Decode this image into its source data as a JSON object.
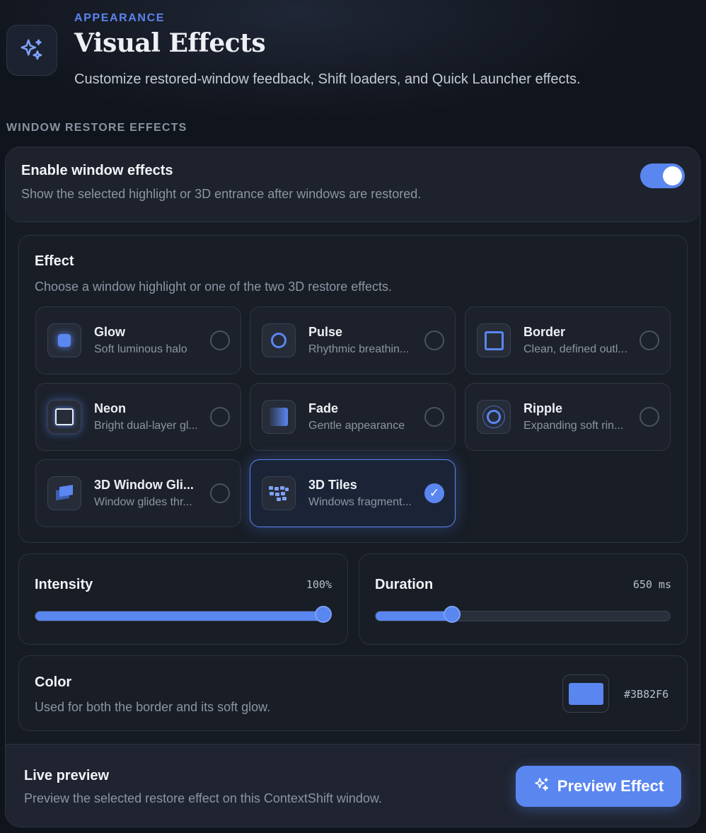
{
  "header": {
    "eyebrow": "APPEARANCE",
    "title": "Visual Effects",
    "subtitle": "Customize restored-window feedback, Shift loaders, and Quick Launcher effects.",
    "icon": "sparkles-icon"
  },
  "section_label": "WINDOW RESTORE EFFECTS",
  "enable": {
    "title": "Enable window effects",
    "description": "Show the selected highlight or 3D entrance after windows are restored.",
    "enabled": true
  },
  "effect": {
    "title": "Effect",
    "description": "Choose a window highlight or one of the two 3D restore effects.",
    "selected": "3D Tiles",
    "options": [
      {
        "name": "Glow",
        "subtitle": "Soft luminous halo",
        "icon": "glow-icon"
      },
      {
        "name": "Pulse",
        "subtitle": "Rhythmic breathin...",
        "icon": "pulse-icon"
      },
      {
        "name": "Border",
        "subtitle": "Clean, defined outl...",
        "icon": "border-icon"
      },
      {
        "name": "Neon",
        "subtitle": "Bright dual-layer gl...",
        "icon": "neon-icon"
      },
      {
        "name": "Fade",
        "subtitle": "Gentle appearance",
        "icon": "fade-icon"
      },
      {
        "name": "Ripple",
        "subtitle": "Expanding soft rin...",
        "icon": "ripple-icon"
      },
      {
        "name": "3D Window Gli...",
        "subtitle": "Window glides thr...",
        "icon": "window-glide-icon"
      },
      {
        "name": "3D Tiles",
        "subtitle": "Windows fragment...",
        "icon": "tiles-icon"
      }
    ]
  },
  "intensity": {
    "label": "Intensity",
    "value_text": "100%",
    "fraction": 1.0
  },
  "duration": {
    "label": "Duration",
    "value_text": "650 ms",
    "fraction": 0.26
  },
  "color": {
    "title": "Color",
    "description": "Used for both the border and its soft glow.",
    "hex": "#3B82F6",
    "swatch": "#5a86f0"
  },
  "preview": {
    "title": "Live preview",
    "description": "Preview the selected restore effect on this ContextShift window.",
    "button_label": "Preview Effect"
  },
  "colors": {
    "accent": "#5a86f0",
    "background": "#10141c"
  }
}
